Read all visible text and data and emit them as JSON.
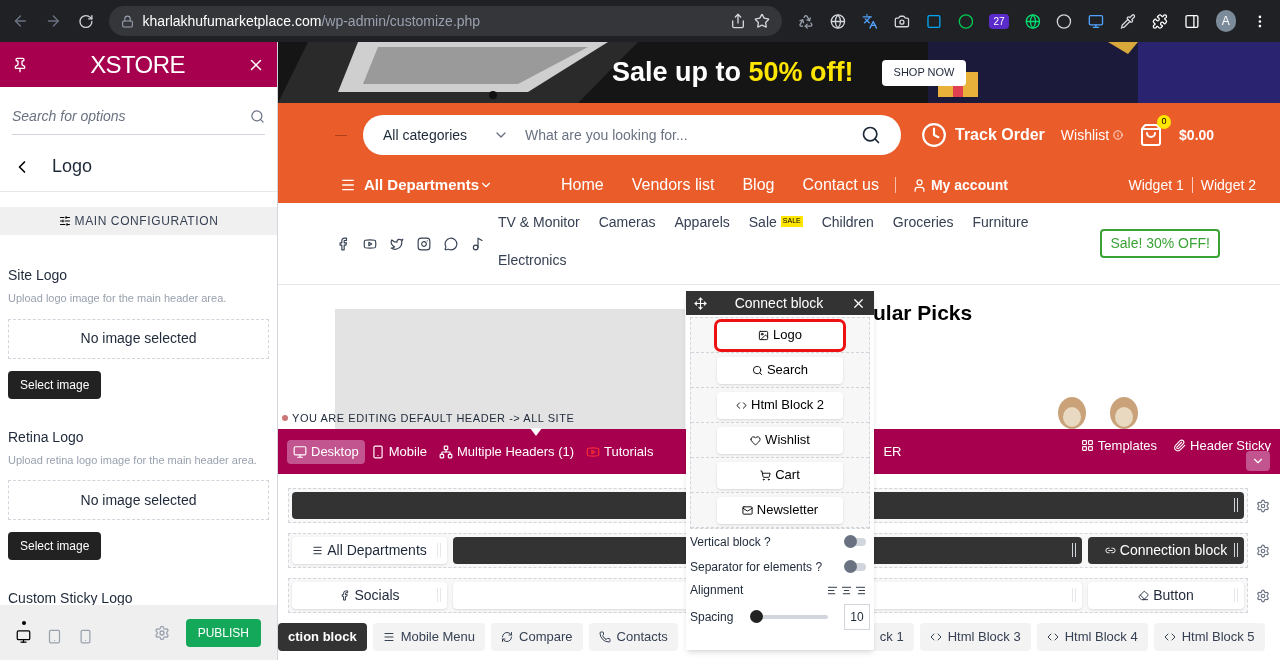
{
  "browser": {
    "url_host": "kharlakhufumarketplace.com",
    "url_path": "/wp-admin/customize.php",
    "extension_badge": "27",
    "avatar": "A"
  },
  "sidebar": {
    "brand": "XSTORE",
    "search_placeholder": "Search for options",
    "back_title": "Logo",
    "section": "MAIN CONFIGURATION",
    "fields": [
      {
        "label": "Site Logo",
        "help": "Upload logo image for the main header area.",
        "empty": "No image selected",
        "button": "Select image"
      },
      {
        "label": "Retina Logo",
        "help": "Upload retina logo image for the main header area.",
        "empty": "No image selected",
        "button": "Select image"
      }
    ],
    "last_label": "Custom Sticky Logo",
    "devices": [
      {
        "selected": true
      },
      {
        "selected": false
      },
      {
        "selected": false
      }
    ],
    "publish": "PUBLISH"
  },
  "banner": {
    "headline_start": "Sale up to",
    "headline_highlight": "50% off!",
    "button": "SHOP NOW"
  },
  "header": {
    "category": "All categories",
    "search_placeholder": "What are you looking for...",
    "track_order": "Track Order",
    "wishlist": "Wishlist",
    "cart_count": "0",
    "cart_total": "$0.00",
    "departments": "All Departments",
    "nav": [
      "Home",
      "Vendors list",
      "Blog",
      "Contact us"
    ],
    "account": "My account",
    "widgets": [
      "Widget 1",
      "Widget 2"
    ]
  },
  "menu": {
    "categories": [
      {
        "label": "TV & Monitor"
      },
      {
        "label": "Cameras"
      },
      {
        "label": "Apparels"
      },
      {
        "label": "Sale",
        "badge": "SALE"
      },
      {
        "label": "Children"
      },
      {
        "label": "Groceries"
      },
      {
        "label": "Furniture"
      },
      {
        "label": "Electronics"
      }
    ],
    "sale_button": "Sale! 30% OFF!"
  },
  "content": {
    "heading": "ular Picks"
  },
  "builder": {
    "notice": "YOU ARE EDITING DEFAULT HEADER -> ALL SITE",
    "tabs": [
      {
        "label": "Desktop",
        "selected": true
      },
      {
        "label": "Mobile",
        "selected": false
      },
      {
        "label": "Multiple Headers (1)",
        "selected": false
      },
      {
        "label": "Tutorials",
        "selected": false
      }
    ],
    "tab_tail": "ER",
    "tools": [
      "Templates",
      "Header Sticky"
    ],
    "rows": [
      [
        {
          "kind": "dark"
        }
      ],
      [
        {
          "kind": "light",
          "label": "All Departments"
        },
        {
          "kind": "dark"
        },
        {
          "kind": "dark",
          "label": "Connection block"
        }
      ],
      [
        {
          "kind": "light",
          "label": "Socials"
        },
        {
          "kind": "light"
        },
        {
          "kind": "light",
          "label": "Button"
        }
      ]
    ],
    "elements": [
      {
        "label": "ction block",
        "selected": true
      },
      {
        "label": "Mobile Menu",
        "selected": false
      },
      {
        "label": "Compare",
        "selected": false
      },
      {
        "label": "Contacts",
        "selected": false
      },
      {
        "label": "ck 1",
        "selected": false
      },
      {
        "label": "Html Block 3",
        "selected": false
      },
      {
        "label": "Html Block 4",
        "selected": false
      },
      {
        "label": "Html Block 5",
        "selected": false
      }
    ]
  },
  "popup": {
    "title": "Connect block",
    "items": [
      {
        "label": "Logo",
        "selected": true
      },
      {
        "label": "Search",
        "selected": false
      },
      {
        "label": "Html Block 2",
        "selected": false
      },
      {
        "label": "Wishlist",
        "selected": false
      },
      {
        "label": "Cart",
        "selected": false
      },
      {
        "label": "Newsletter",
        "selected": false
      }
    ],
    "toggles": [
      {
        "label": "Vertical block ?",
        "on": false
      },
      {
        "label": "Separator for elements ?",
        "on": false
      }
    ],
    "alignment_label": "Alignment",
    "spacing_label": "Spacing",
    "spacing": {
      "level": 0.05,
      "value": "10"
    }
  }
}
